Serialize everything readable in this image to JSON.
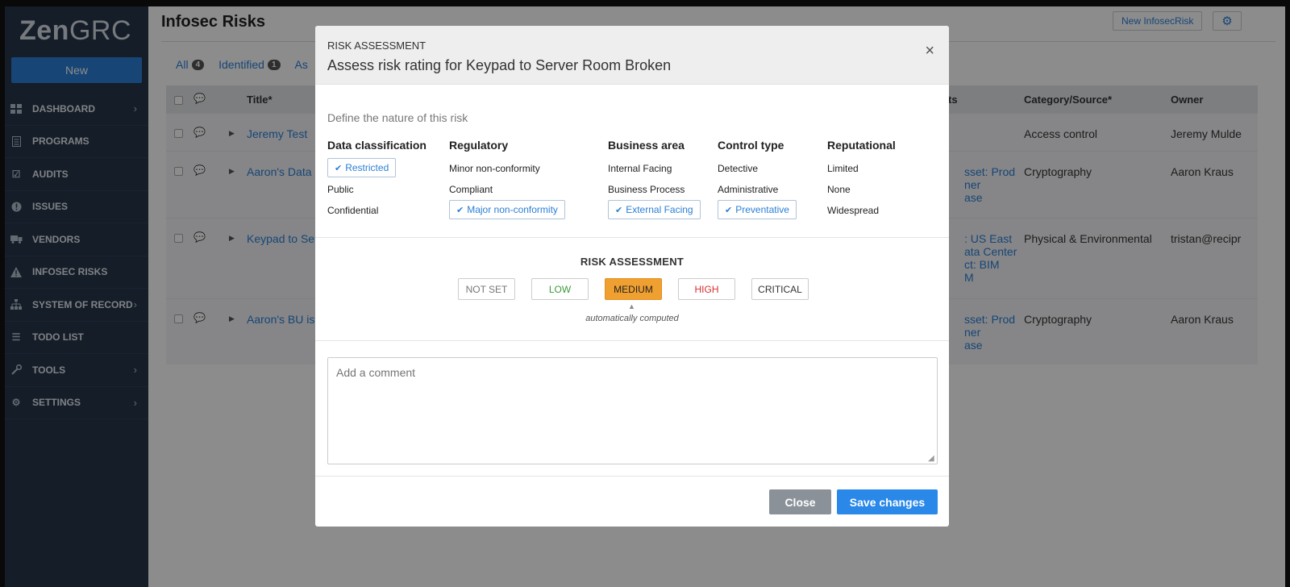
{
  "sidebar": {
    "logo_bold": "Zen",
    "logo_light": "GRC",
    "new_label": "New",
    "items": [
      {
        "label": "DASHBOARD",
        "icon": "dashboard-icon",
        "chevron": true
      },
      {
        "label": "PROGRAMS",
        "icon": "document-icon",
        "chevron": false
      },
      {
        "label": "AUDITS",
        "icon": "checkbox-icon",
        "chevron": false
      },
      {
        "label": "ISSUES",
        "icon": "alert-circle-icon",
        "chevron": false
      },
      {
        "label": "VENDORS",
        "icon": "truck-icon",
        "chevron": false
      },
      {
        "label": "INFOSEC RISKS",
        "icon": "warning-icon",
        "chevron": false
      },
      {
        "label": "SYSTEM OF RECORD",
        "icon": "hierarchy-icon",
        "chevron": true
      },
      {
        "label": "TODO LIST",
        "icon": "list-icon",
        "chevron": false
      },
      {
        "label": "TOOLS",
        "icon": "wrench-icon",
        "chevron": true
      },
      {
        "label": "SETTINGS",
        "icon": "gear-icon",
        "chevron": true
      }
    ]
  },
  "header": {
    "title": "Infosec Risks",
    "new_button": "New InfosecRisk"
  },
  "tabs": [
    {
      "label": "All",
      "count": "4"
    },
    {
      "label": "Identified",
      "count": "1"
    },
    {
      "label": "As",
      "count": ""
    }
  ],
  "table": {
    "columns": [
      "Title*",
      "ts",
      "Category/Source*",
      "Owner"
    ],
    "rows": [
      {
        "title": "Jeremy Test",
        "assets": [],
        "category": "Access control",
        "owner": "Jeremy Mulde"
      },
      {
        "title": "Aaron's Data In",
        "assets": [
          "sset: Prod",
          "ner",
          "ase"
        ],
        "category": "Cryptography",
        "owner": "Aaron Kraus"
      },
      {
        "title": "Keypad to Serv",
        "assets": [
          ": US East",
          "ata Center",
          "ct: BIM",
          "M"
        ],
        "category": "Physical & Environmental",
        "owner": "tristan@recipr"
      },
      {
        "title": "Aaron's BU is s",
        "assets": [
          "sset: Prod",
          "ner",
          "ase"
        ],
        "category": "Cryptography",
        "owner": "Aaron Kraus"
      }
    ]
  },
  "modal": {
    "eyebrow": "RISK ASSESSMENT",
    "title": "Assess risk rating for Keypad to Server Room Broken",
    "subtitle": "Define the nature of this risk",
    "columns": [
      {
        "heading": "Data classification",
        "options": [
          "Restricted",
          "Public",
          "Confidential"
        ],
        "selected": 0
      },
      {
        "heading": "Regulatory",
        "options": [
          "Minor non-conformity",
          "Compliant",
          "Major non-conformity"
        ],
        "selected": 2
      },
      {
        "heading": "Business area",
        "options": [
          "Internal Facing",
          "Business Process",
          "External Facing"
        ],
        "selected": 2
      },
      {
        "heading": "Control type",
        "options": [
          "Detective",
          "Administrative",
          "Preventative"
        ],
        "selected": 2
      },
      {
        "heading": "Reputational",
        "options": [
          "Limited",
          "None",
          "Widespread"
        ],
        "selected": -1
      }
    ],
    "assessment_label": "RISK ASSESSMENT",
    "levels": [
      "NOT SET",
      "LOW",
      "MEDIUM",
      "HIGH",
      "CRITICAL"
    ],
    "active_level": "MEDIUM",
    "computed_note": "automatically computed",
    "comment_placeholder": "Add a comment",
    "close_label": "Close",
    "save_label": "Save changes"
  },
  "colors": {
    "sidebar_bg": "#26364a",
    "accent": "#2a7fd6",
    "medium": "#f0a030",
    "low": "#3a9a3a",
    "high": "#d63030"
  }
}
